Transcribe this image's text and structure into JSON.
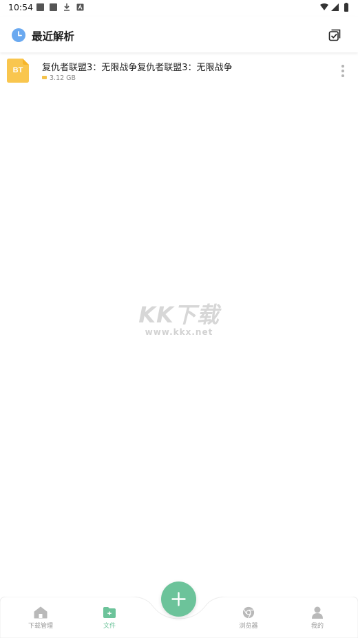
{
  "status_bar": {
    "time": "10:54"
  },
  "header": {
    "title": "最近解析",
    "clock_icon": "clock-icon",
    "action_icon": "select-all-icon"
  },
  "files": [
    {
      "icon_label": "BT",
      "name": "复仇者联盟3：无限战争复仇者联盟3：无限战争",
      "size": "3.12 GB"
    }
  ],
  "watermark": {
    "title": "KK下载",
    "url": "www.kkx.net"
  },
  "bottom_nav": {
    "items": [
      {
        "label": "下载管理",
        "icon": "home-icon"
      },
      {
        "label": "文件",
        "icon": "folder-plus-icon",
        "active": true
      },
      {
        "label": "浏览器",
        "icon": "browser-icon"
      },
      {
        "label": "我的",
        "icon": "user-icon"
      }
    ],
    "fab_icon": "plus-icon"
  },
  "colors": {
    "accent": "#6cc39a",
    "bt_icon": "#f9c64e",
    "clock": "#6aa9f0"
  }
}
